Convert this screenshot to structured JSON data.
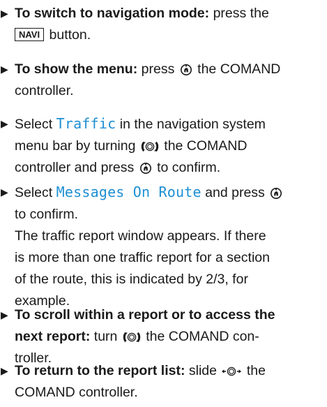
{
  "steps": [
    {
      "lead": "To switch to navigation mode:",
      "text_a": " press the",
      "key": "NAVI",
      "text_b": " button."
    },
    {
      "lead": "To show the menu:",
      "text_a": " press",
      "text_b": " the COMAND",
      "text_c": "controller."
    },
    {
      "text_a": "Select ",
      "term": "Traffic",
      "text_b": " in the navigation system",
      "text_c": "menu bar by turning",
      "text_d": " the COMAND",
      "text_e": "controller and press",
      "text_f": " to confirm."
    },
    {
      "text_a": "Select ",
      "term": "Messages On Route",
      "text_b": " and press",
      "text_c": "to confirm.",
      "result_1": "The traffic report window appears. If there",
      "result_2": "is more than one traffic report for a section",
      "result_3": "of the route, this is indicated by 2/3, for",
      "result_4": "example."
    },
    {
      "lead_1": "To scroll within a report or to access the",
      "lead_2": "next report:",
      "text_a": " turn",
      "text_b": " the COMAND con-",
      "text_c": "troller."
    },
    {
      "lead": "To return to the report list:",
      "text_a": " slide",
      "text_b": " the",
      "text_c": "COMAND controller."
    }
  ],
  "icons": {
    "bullet": "triangle-right-icon",
    "press": "controller-press-icon",
    "turn": "controller-turn-icon",
    "slide": "controller-slide-left-right-icon"
  },
  "colors": {
    "text": "#1a1a1a",
    "menu_term": "#1e8fd3"
  }
}
